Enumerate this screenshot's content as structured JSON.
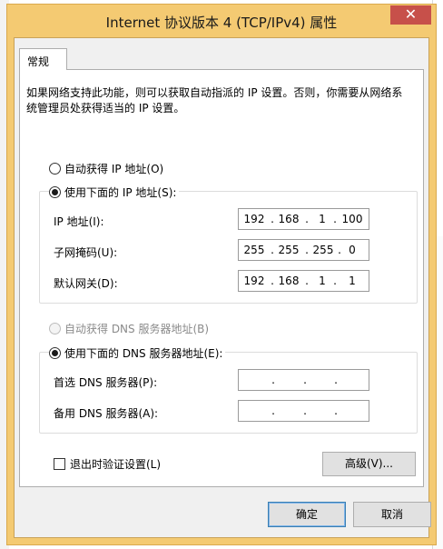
{
  "window": {
    "title": "Internet 协议版本 4 (TCP/IPv4) 属性",
    "close_glyph": "✕"
  },
  "tabs": [
    {
      "label": "常规"
    }
  ],
  "description": "如果网络支持此功能，则可以获取自动指派的 IP 设置。否则，你需要从网络系统管理员处获得适当的 IP 设置。",
  "ip_mode": {
    "auto_label": "自动获得 IP 地址(O)",
    "manual_label": "使用下面的 IP 地址(S):",
    "selected": "manual"
  },
  "ip_fields": {
    "ip_address": {
      "label": "IP 地址(I):",
      "octets": [
        "192",
        "168",
        "1",
        "100"
      ]
    },
    "subnet_mask": {
      "label": "子网掩码(U):",
      "octets": [
        "255",
        "255",
        "255",
        "0"
      ]
    },
    "default_gateway": {
      "label": "默认网关(D):",
      "octets": [
        "192",
        "168",
        "1",
        "1"
      ]
    }
  },
  "dns_mode": {
    "auto_label": "自动获得 DNS 服务器地址(B)",
    "manual_label": "使用下面的 DNS 服务器地址(E):",
    "selected": "manual",
    "auto_disabled": true
  },
  "dns_fields": {
    "preferred": {
      "label": "首选 DNS 服务器(P):",
      "octets": [
        "",
        "",
        "",
        ""
      ]
    },
    "alternate": {
      "label": "备用 DNS 服务器(A):",
      "octets": [
        "",
        "",
        "",
        ""
      ]
    }
  },
  "validate_on_exit": {
    "label": "退出时验证设置(L)",
    "checked": false
  },
  "buttons": {
    "advanced": "高级(V)...",
    "ok": "确定",
    "cancel": "取消"
  },
  "colors": {
    "title_frame": "#f4ca72",
    "close_button": "#c7504a",
    "dialog_face": "#f0f0f0"
  }
}
